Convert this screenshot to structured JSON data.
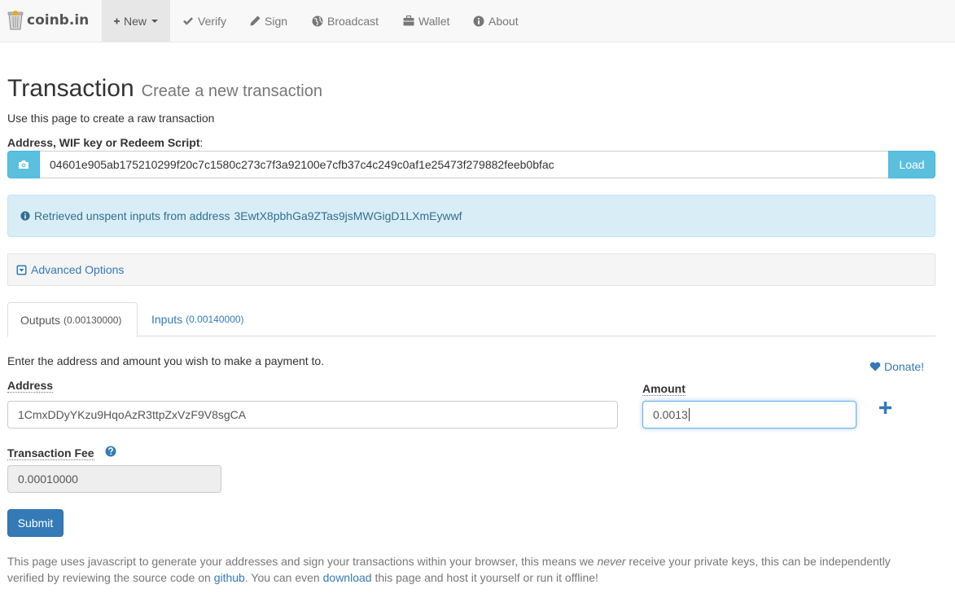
{
  "brand": {
    "name": "coinb.in",
    "logo_icon": "bitcoin-bin-icon"
  },
  "nav": [
    {
      "label": "New",
      "icon": "plus-icon",
      "active": true
    },
    {
      "label": "Verify",
      "icon": "check-icon"
    },
    {
      "label": "Sign",
      "icon": "pencil-icon"
    },
    {
      "label": "Broadcast",
      "icon": "globe-icon"
    },
    {
      "label": "Wallet",
      "icon": "briefcase-icon"
    },
    {
      "label": "About",
      "icon": "info-icon"
    }
  ],
  "page": {
    "title": "Transaction",
    "subtitle": "Create a new transaction",
    "intro": "Use this page to create a raw transaction"
  },
  "address_input": {
    "label": "Address, WIF key or Redeem Script",
    "label_suffix": ":",
    "value": "04601e905ab175210299f20c7c1580c273c7f3a92100e7cfb37c4c249c0af1e25473f279882feeb0bfac",
    "load_button": "Load",
    "camera_icon": "camera-icon"
  },
  "alert": {
    "text": "Retrieved unspent inputs from address",
    "address": "3EwtX8pbhGa9ZTas9jsMWGigD1LXmEywwf"
  },
  "advanced": {
    "label": "Advanced Options"
  },
  "tabs": [
    {
      "label": "Outputs",
      "amount": "(0.00130000)",
      "active": true
    },
    {
      "label": "Inputs",
      "amount": "(0.00140000)",
      "active": false
    }
  ],
  "outputs": {
    "intro": "Enter the address and amount you wish to make a payment to.",
    "donate": "Donate!",
    "address_label": "Address",
    "address_value": "1CmxDDyYKzu9HqoAzR3ttpZxVzF9V8sgCA",
    "amount_label": "Amount",
    "amount_value": "0.0013",
    "fee_label": "Transaction Fee",
    "fee_value": "0.00010000"
  },
  "submit_label": "Submit",
  "footer": {
    "part1": "This page uses javascript to generate your addresses and sign your transactions within your browser, this means we ",
    "emph": "never",
    "part2": " receive your private keys, this can be independently verified by reviewing the source code on ",
    "github": "github",
    "part3": ". You can even ",
    "download": "download",
    "part4": " this page and host it yourself or run it offline!"
  },
  "colors": {
    "info": "#5bc0de",
    "primary": "#337ab7",
    "alert_bg": "#d9edf7",
    "alert_text": "#31708f"
  }
}
